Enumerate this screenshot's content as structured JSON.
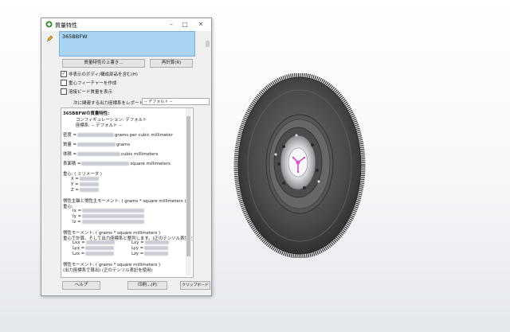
{
  "dialog": {
    "title": "質量特性",
    "selected_item": "365BBFW",
    "override_button": "質量特性の上書き...",
    "recalc_button": "再計算(R)",
    "checkboxes": [
      {
        "label": "非表示のボディ/構成部品を含む(H)",
        "checked": true
      },
      {
        "label": "重心フィーチャーを作成",
        "checked": false
      },
      {
        "label": "溶接ビード質量を表示",
        "checked": false
      }
    ],
    "coord_label": "次に関連する出力座標系をレポート:",
    "coord_value": "-- デフォルト --",
    "help_button": "ヘルプ",
    "print_button": "印刷...(P)",
    "clipboard_button": "クリップボード"
  },
  "results": {
    "heading": "365BBFWの質量特性:",
    "config": "コンフィギュレーション: デフォルト",
    "coord_sys": "座標系: -- デフォルト --",
    "density_label": "密度 =",
    "density_unit": "grams per cubic millimeter",
    "mass_label": "質量 =",
    "mass_unit": "grams",
    "volume_label": "体積 =",
    "volume_unit": "cubic millimeters",
    "area_label": "表面積 =",
    "area_unit": "square millimeters",
    "cog_label": "重心: ( ミリメータ )",
    "x_label": "X =",
    "y_label": "Y =",
    "z_label": "Z =",
    "principal_heading": "慣性主軸と慣性主モーメント: ( grams * square millimeters )",
    "principal_sub": "重心:",
    "ix": "Ix =",
    "iy": "Iy =",
    "iz": "Iz =",
    "moment_heading": "慣性モーメント: ( grams * square millimeters )",
    "moment_sub": "重心で計算。そして出力座標系と整列します。(正のテンソル表記を使",
    "lxx": "Lxx =",
    "lxy": "Lxy =",
    "lyx": "Lyx =",
    "lyy": "Lyy =",
    "lzx": "Lzx =",
    "lzy": "Lzy =",
    "moment_heading2": "慣性モーメント: ( grams * square millimeters )",
    "moment_sub2": "(出力座標系で算出) (正のテンソル表記を使用)"
  },
  "icons": {
    "app": "solidworks-icon",
    "pin": "pushpin-icon",
    "part": "flywheel-part"
  },
  "colors": {
    "selection": "#a8d4f2",
    "part_body": "#4a4a4a",
    "triad": "#d050c8"
  }
}
